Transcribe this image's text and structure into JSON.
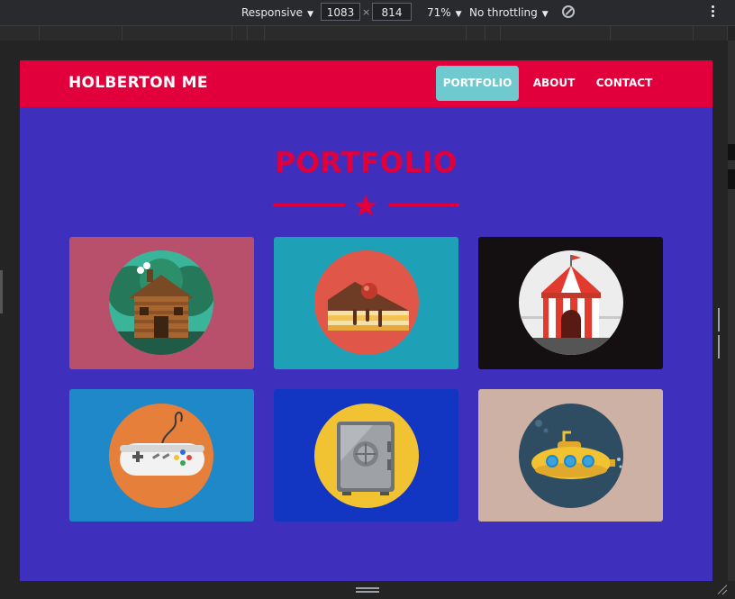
{
  "devtools": {
    "device": "Responsive",
    "width": "1083",
    "times": "×",
    "height": "814",
    "zoom": "71%",
    "throttling": "No throttling"
  },
  "site": {
    "brand": "HOLBERTON ME",
    "nav": [
      {
        "label": "PORTFOLIO",
        "active": true
      },
      {
        "label": "ABOUT",
        "active": false
      },
      {
        "label": "CONTACT",
        "active": false
      }
    ],
    "heading": "PORTFOLIO",
    "colors": {
      "nav": "#e1003b",
      "body": "#3f2fbd",
      "active": "#6fcad0"
    },
    "portfolio": [
      {
        "icon": "log-cabin-icon",
        "bg": "#b9506b",
        "circle": "#3bb59a"
      },
      {
        "icon": "cake-slice-icon",
        "bg": "#1ea0b6",
        "circle": "#e0574a"
      },
      {
        "icon": "circus-tent-icon",
        "bg": "#141012",
        "circle": "#ededed"
      },
      {
        "icon": "gamepad-icon",
        "bg": "#1e88c8",
        "circle": "#e67f3a"
      },
      {
        "icon": "safe-icon",
        "bg": "#1336c2",
        "circle": "#f1c232"
      },
      {
        "icon": "submarine-icon",
        "bg": "#cdb1a5",
        "circle": "#2e4d63"
      }
    ]
  }
}
